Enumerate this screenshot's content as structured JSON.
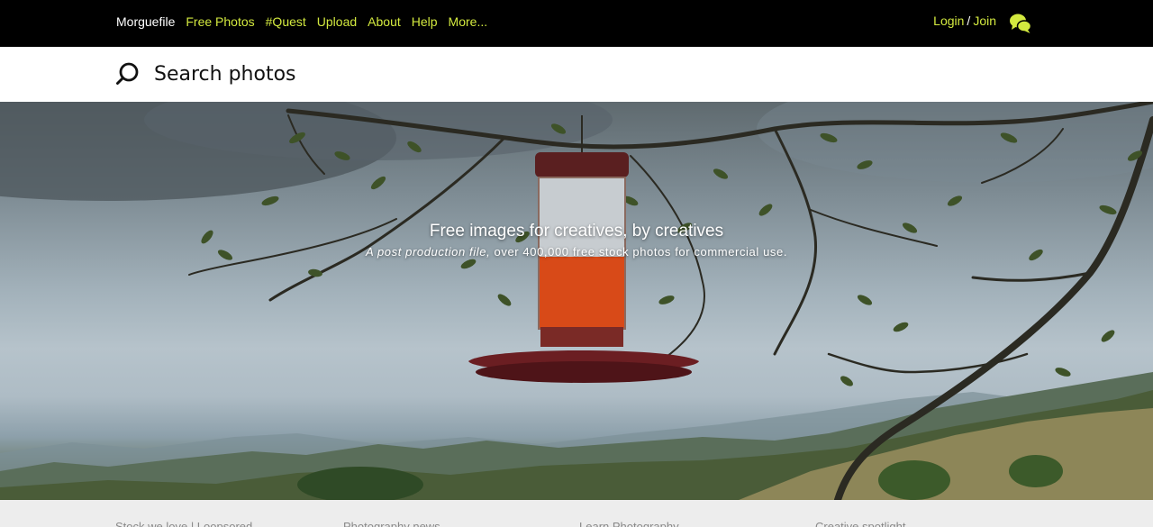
{
  "nav": {
    "brand": "Morguefile",
    "links": [
      "Free Photos",
      "#Quest",
      "Upload",
      "About",
      "Help",
      "More..."
    ],
    "login": "Login",
    "separator": "/",
    "join": "Join",
    "chat_icon": "chat-bubbles-icon",
    "colors": {
      "background": "#000000",
      "accent": "#d3e93f",
      "brand_text": "#ffffff"
    }
  },
  "search": {
    "placeholder": "Search photos",
    "icon": "search-icon"
  },
  "hero": {
    "title": "Free images for creatives, by creatives",
    "subtitle_italic": "A post production file,",
    "subtitle_rest": " over 400,000 free stock photos for commercial use."
  },
  "footer": {
    "columns": [
      "Stock we love | Loopsored",
      "Photography news",
      "Learn Photography",
      "Creative spotlight"
    ]
  }
}
